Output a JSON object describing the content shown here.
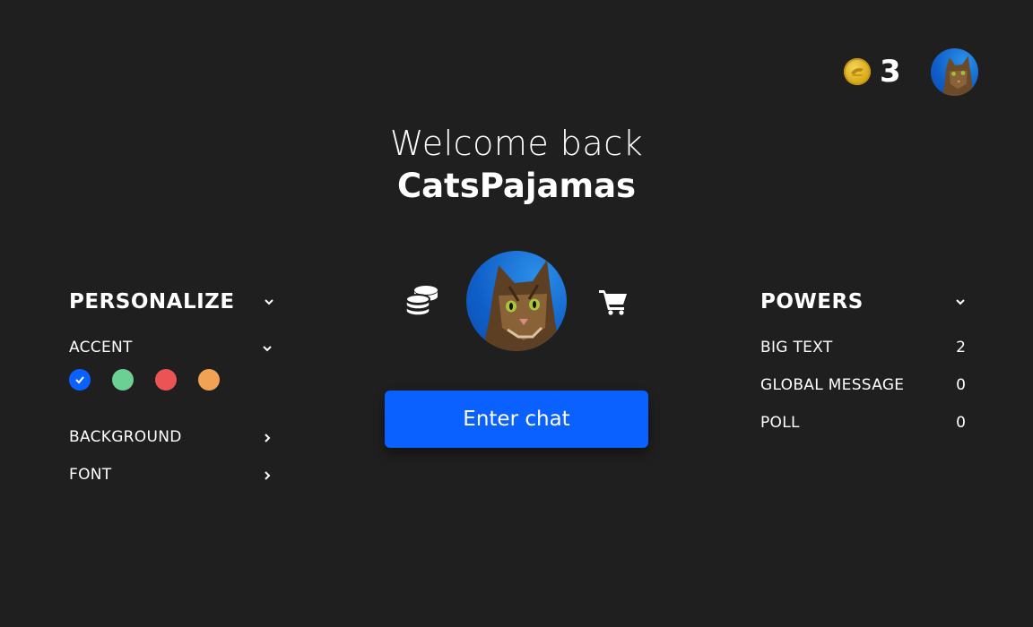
{
  "header": {
    "coin_count": "3",
    "icons": [
      "coin-icon",
      "user-avatar"
    ]
  },
  "welcome": {
    "greeting": "Welcome back",
    "username": "CatsPajamas"
  },
  "center": {
    "enter_chat_label": "Enter chat",
    "icons": [
      "coins-stack-icon",
      "cart-icon"
    ]
  },
  "personalize": {
    "title": "PERSONALIZE",
    "accent_label": "ACCENT",
    "accent_colors": [
      "#0b61ff",
      "#6ccf93",
      "#ec5354",
      "#f2a255"
    ],
    "selected_accent": "#0b61ff",
    "background_label": "BACKGROUND",
    "font_label": "FONT"
  },
  "powers": {
    "title": "POWERS",
    "items": [
      {
        "label": "BIG TEXT",
        "value": "2"
      },
      {
        "label": "GLOBAL MESSAGE",
        "value": "0"
      },
      {
        "label": "POLL",
        "value": "0"
      }
    ]
  },
  "colors": {
    "background": "#1f1f1f",
    "accent": "#0b61ff",
    "coin": "#d7a915"
  }
}
